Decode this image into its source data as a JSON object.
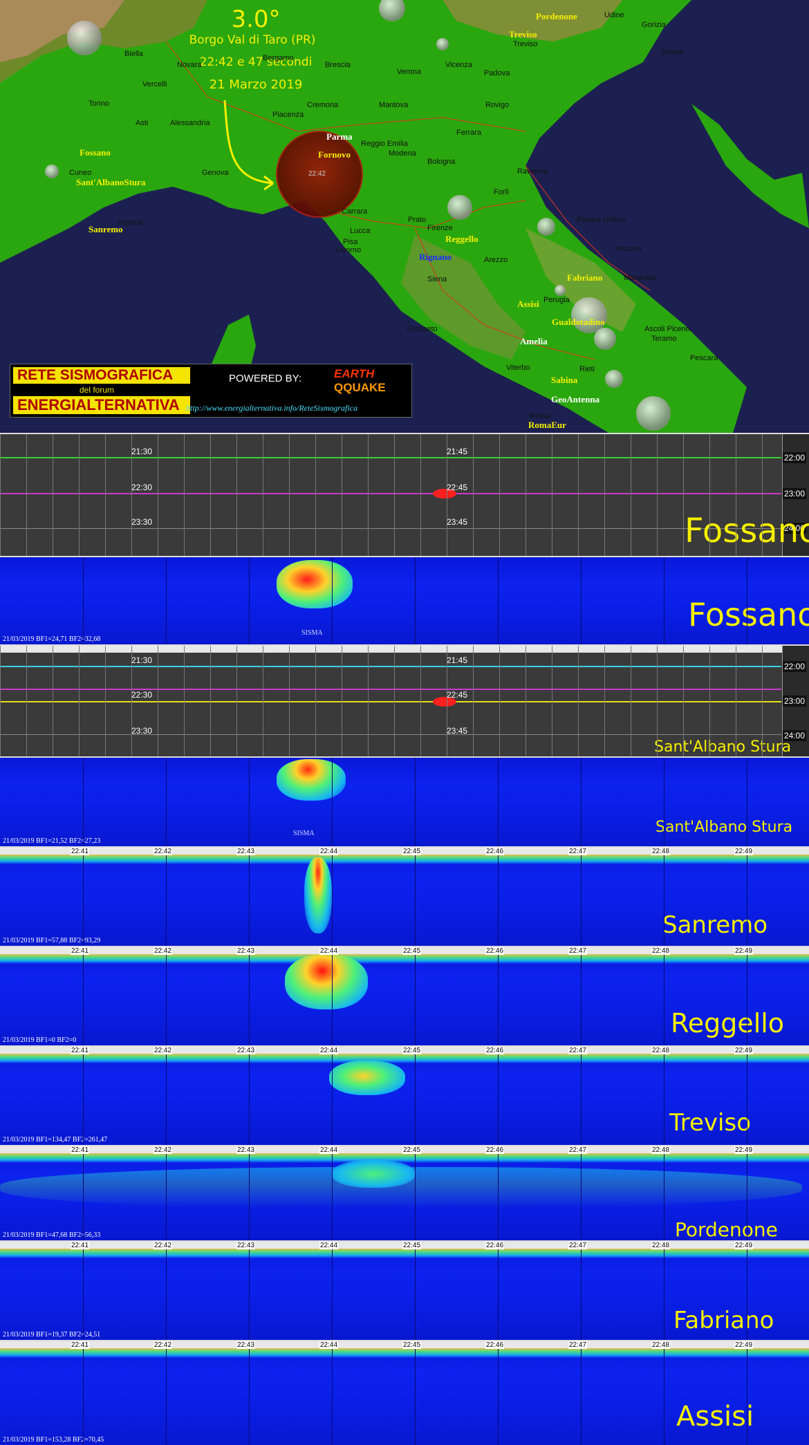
{
  "map": {
    "event": {
      "magnitude": "3.0°",
      "location": "Borgo Val di Taro (PR)",
      "time": "22:42 e 47 secondi",
      "date": "21 Marzo 2019",
      "marker_label": "22:42"
    },
    "stations": [
      "Pordenone",
      "Treviso",
      "Parma",
      "Fornovo",
      "Fossano",
      "Sant'AlbanoStura",
      "Sanremo",
      "Reggello",
      "Rignano",
      "Fabriano",
      "Assisi",
      "Gualdotadino",
      "Amelia",
      "Sabina",
      "GeoAntenna",
      "RomaEur"
    ],
    "cities": [
      "Udine",
      "Gorizia",
      "Trieste",
      "Treviso",
      "Padova",
      "Vicenza",
      "Verona",
      "Brescia",
      "Bergamo",
      "Novara",
      "Biella",
      "Vercelli",
      "Torino",
      "Asti",
      "Alessandria",
      "Cuneo",
      "Genova",
      "Imperia",
      "Cremona",
      "Mantova",
      "Piacenza",
      "Reggio Emilia",
      "Modena",
      "Bologna",
      "Ferrara",
      "Rovigo",
      "Ravenna",
      "Forlì",
      "Pesaro Urbino",
      "Ancona",
      "Macerata",
      "Perugia",
      "Arezzo",
      "Siena",
      "Firenze",
      "Prato",
      "Lucca",
      "Pisa",
      "Livorno",
      "Carrara",
      "Grosseto",
      "Viterbo",
      "Teramo",
      "Ascoli Piceno",
      "Pescara",
      "Rieti",
      "Roma"
    ],
    "logo": {
      "line1": "RETE SISMOGRAFICA",
      "line2": "del forum",
      "line3": "ENERGIALTERNATIVA",
      "powered": "POWERED BY:",
      "brand_a": "EARTH",
      "brand_b": "QQUAKE",
      "url": "http://www.energialternativa.info/ReteSismografica"
    }
  },
  "helicorders": [
    {
      "station": "Fossano",
      "left_times": [
        "21:30",
        "22:30",
        "23:30"
      ],
      "mid_times": [
        "21:45",
        "22:45",
        "23:45"
      ],
      "right_times": [
        "22:00",
        "23:00",
        "24:00"
      ]
    },
    {
      "station": "Sant'Albano Stura",
      "left_times": [
        "21:30",
        "22:30",
        "23:30"
      ],
      "mid_times": [
        "21:45",
        "22:45",
        "23:45"
      ],
      "right_times": [
        "22:00",
        "23:00",
        "24:00"
      ]
    }
  ],
  "spectrograms": [
    {
      "station": "Fossano",
      "info": "21/03/2019 BF1=24,71 BF2=32,68",
      "sisma": "SISMA"
    },
    {
      "station": "Sant'Albano Stura",
      "info": "21/03/2019 BF1=21,52 BF2=27,23",
      "sisma": "SISMA"
    },
    {
      "station": "Sanremo",
      "info": "21/03/2019 BF1=57,88 BF2=93,29",
      "sisma": ""
    },
    {
      "station": "Reggello",
      "info": "21/03/2019 BF1=0 BF2=0",
      "sisma": ""
    },
    {
      "station": "Treviso",
      "info": "21/03/2019 BF1=134,47 BF2=261,47",
      "sisma": ""
    },
    {
      "station": "Pordenone",
      "info": "21/03/2019 BF1=47,68 BF2=56,33",
      "sisma": ""
    },
    {
      "station": "Fabriano",
      "info": "21/03/2019 BF1=19,37 BF2=24,51",
      "sisma": ""
    },
    {
      "station": "Assisi",
      "info": "21/03/2019 BF1=153,28 BF2=70,45",
      "sisma": ""
    }
  ],
  "time_ticks": [
    "22:41",
    "22:42",
    "22:43",
    "22:44",
    "22:45",
    "22:46",
    "22:47",
    "22:48",
    "22:49"
  ]
}
